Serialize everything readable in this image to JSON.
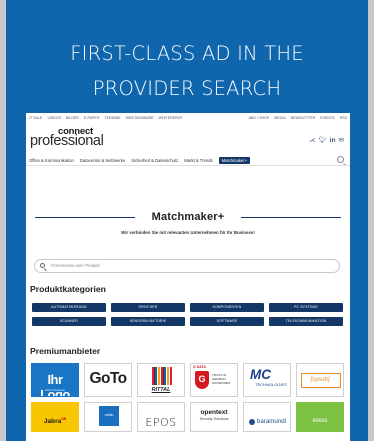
{
  "headline": {
    "line1": "FIRST-CLASS AD IN THE",
    "line2": "PROVIDER SEARCH"
  },
  "site": {
    "top_nav_left": [
      "IT SALE",
      "VIDEOS",
      "BILDER",
      "E-PAPER",
      "TERMINE",
      "WEB SEMINARE",
      "WHITEPAPER"
    ],
    "top_nav_right": [
      "ABO / SHOP",
      "MEDIA",
      "NEWSLETTER",
      "EVENTS",
      "RSS"
    ],
    "logo_top": "connect",
    "logo_bottom": "professional",
    "social": [
      "share-icon",
      "twitter-icon",
      "linkedin-icon",
      "mail-icon"
    ],
    "categories_nav": [
      "Office & Kommunikation",
      "Datacenter & Netzwerke",
      "Sicherheit & Datenschutz",
      "Markt & Trends"
    ],
    "matchmaker_button": "Matchmaker+"
  },
  "matchmaker": {
    "title": "Matchmaker+",
    "subtitle": "Wir verbinden Sie mit relevanten Unternehmen für Ihr Business!",
    "search_placeholder": "Firmenname oder Produkt"
  },
  "product_categories": {
    "heading": "Produktkategorien",
    "items": [
      "AUTOMATISIERUNG",
      "SPEICHER",
      "KOMPONENTEN",
      "PC SYSTEME",
      "SCANNER",
      "SENSORIK/AKTORIK",
      "SOFTWARE",
      "TELEKOMMUNIKATION"
    ]
  },
  "premium_providers": {
    "heading": "Premiumanbieter",
    "row1": {
      "ihr_logo": "Ihr Logo",
      "ihr_logo_sub": "AICS business",
      "goto": "GoTo",
      "rittal": "RITTAL",
      "gdata": "G DATA",
      "gdata_trust": "TRUST IN GERMAN SICHERHEIT",
      "mc": "MC",
      "mc_sub": "TECHNOLOGIES",
      "sysob": "[sysob]"
    },
    "row2": {
      "jabra": "Jabra",
      "jabra_sup": "GN",
      "blue": "unblu",
      "epos": "EPOS",
      "opentext": "opentext",
      "opentext_sub": "Security Solutions",
      "baramundi": "baramundi",
      "estos": "estos"
    }
  },
  "colors": {
    "card_blue": "#0f66ad",
    "nav_dark": "#133767"
  }
}
